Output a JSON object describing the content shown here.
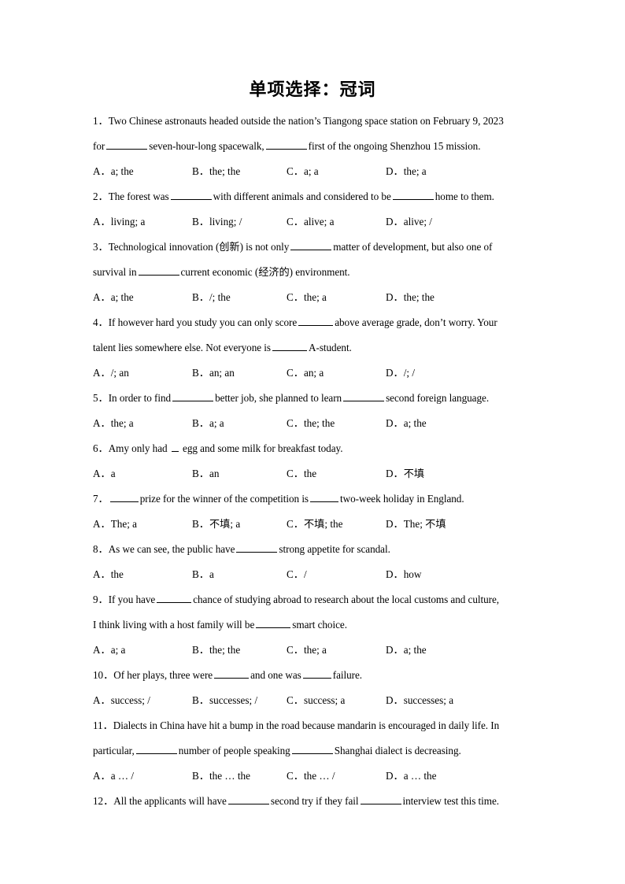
{
  "document": {
    "title": "单项选择：冠词",
    "blank_marker": "______"
  },
  "questions": [
    {
      "number": "1．",
      "lines": [
        "Two Chinese astronauts headed outside the nation’s Tiangong space station on February 9, 2023",
        "for ________ seven-hour-long spacewalk, ________ first of the ongoing Shenzhou 15 mission."
      ],
      "line1_text": "Two Chinese astronauts headed outside the nation’s Tiangong space station on February 9, 2023",
      "line2_pre": "for",
      "line2_mid": "seven-hour-long spacewalk,",
      "line2_post": "first of the ongoing Shenzhou 15 mission.",
      "options": {
        "a": "A．a; the",
        "b": "B．the; the",
        "c": "C．a; a",
        "d": "D．the; a"
      }
    },
    {
      "number": "2．",
      "line1_pre": "The forest was",
      "line1_mid": "with different animals and considered to be",
      "line1_post": "home to them.",
      "options": {
        "a": "A．living; a",
        "b": "B．living; /",
        "c": "C．alive; a",
        "d": "D．alive; /"
      }
    },
    {
      "number": "3．",
      "line1_pre": "Technological innovation (创新) is not only",
      "line1_post": "matter of development, but also one of",
      "line2_pre": "survival in",
      "line2_post": "current economic (经济的) environment.",
      "options": {
        "a": "A．a; the",
        "b": "B．/; the",
        "c": "C．the; a",
        "d": "D．the; the"
      }
    },
    {
      "number": "4．",
      "line1_pre": "If however hard you study you can only score",
      "line1_post": "above average grade, don’t worry. Your",
      "line2_pre": "talent lies somewhere else. Not everyone is",
      "line2_post": "A-student.",
      "options": {
        "a": "A．/; an",
        "b": "B．an; an",
        "c": "C．an; a",
        "d": "D．/; /"
      }
    },
    {
      "number": "5．",
      "line1_pre": "In order to find",
      "line1_mid": "better job, she planned to learn",
      "line1_post": "second foreign language.",
      "options": {
        "a": "A．the; a",
        "b": "B．a; a",
        "c": "C．the; the",
        "d": "D．a; the"
      }
    },
    {
      "number": "6．",
      "line1_pre": "Amy only had",
      "line1_post": "egg and some milk for breakfast today.",
      "options": {
        "a": "A．a",
        "b": "B．an",
        "c": "C．the",
        "d": "D．不填"
      }
    },
    {
      "number": "7．",
      "line1_pre": "",
      "line1_mid": "prize for the winner of the competition is",
      "line1_post": "two-week holiday in England.",
      "options": {
        "a": "A．The; a",
        "b": "B．不填; a",
        "c": "C．不填; the",
        "d": "D．The; 不填"
      }
    },
    {
      "number": "8．",
      "line1_pre": "As we can see, the public have",
      "line1_post": "strong appetite for scandal.",
      "options": {
        "a": "A．the",
        "b": "B．a",
        "c": "C．/",
        "d": "D．how"
      }
    },
    {
      "number": "9．",
      "line1_pre": "If you have",
      "line1_post": "chance of studying abroad to research about the local customs and culture,",
      "line2_pre": "I think living with a host family will be",
      "line2_post": "smart choice.",
      "options": {
        "a": "A．a; a",
        "b": "B．the; the",
        "c": "C．the; a",
        "d": "D．a; the"
      }
    },
    {
      "number": "10．",
      "line1_pre": "Of her plays, three were",
      "line1_mid": "and one was",
      "line1_post": "failure.",
      "options": {
        "a": "A．success; /",
        "b": "B．successes; /",
        "c": "C．success; a",
        "d": "D．successes; a"
      }
    },
    {
      "number": "11．",
      "line1_text": "Dialects in China have hit a bump in the road because mandarin is encouraged in daily life. In",
      "line2_pre": "particular,",
      "line2_mid": "number of people speaking",
      "line2_post": "Shanghai dialect is decreasing.",
      "options": {
        "a": "A．a … /",
        "b": "B．the … the",
        "c": "C．the … /",
        "d": "D．a … the"
      }
    },
    {
      "number": "12．",
      "line1_pre": "All the applicants will have",
      "line1_mid": "second try if they fail",
      "line1_post": "interview test this time.",
      "options": null
    }
  ]
}
